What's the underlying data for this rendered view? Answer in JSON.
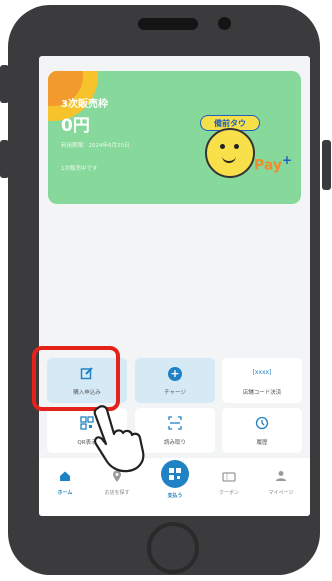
{
  "card": {
    "title": "3次販売枠",
    "amount": "0円",
    "deadline": "利用期限：2024年6月20日",
    "note": "1次販売中です",
    "brand_top": "備前タウ",
    "brand_pay": "Pay",
    "brand_plus": "+"
  },
  "tiles": [
    {
      "label": "購入申込み",
      "icon": "edit-icon"
    },
    {
      "label": "チャージ",
      "icon": "plus-circle-icon"
    },
    {
      "label": "店舗コード決済",
      "icon": "code-icon",
      "icon_text": "[xxxx]"
    },
    {
      "label": "QR表示",
      "icon": "qr-icon"
    },
    {
      "label": "読み取り",
      "icon": "scan-icon"
    },
    {
      "label": "履歴",
      "icon": "clock-icon"
    }
  ],
  "nav": [
    {
      "label": "ホーム",
      "icon": "home-icon",
      "active": true
    },
    {
      "label": "お店を探す",
      "icon": "location-pin-icon"
    },
    {
      "label": "支払う",
      "icon": "qr-pay-icon"
    },
    {
      "label": "クーポン",
      "icon": "coupon-icon"
    },
    {
      "label": "マイページ",
      "icon": "person-icon"
    }
  ],
  "colors": {
    "accent": "#1f82c4",
    "card_bg": "#86d99a",
    "highlight": "#e5211c"
  }
}
